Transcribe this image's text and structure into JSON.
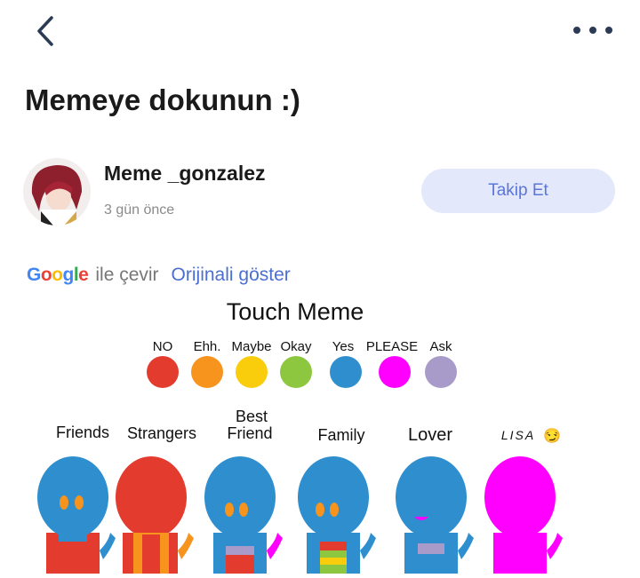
{
  "nav": {
    "back_icon": "chevron-left-icon",
    "more_icon": "more-horizontal-icon"
  },
  "post": {
    "title": "Memeye dokunun :)",
    "author": "Meme _gonzalez",
    "time": "3 gün önce",
    "follow_label": "Takip Et"
  },
  "translate": {
    "google_letters": [
      "G",
      "o",
      "o",
      "g",
      "l",
      "e"
    ],
    "ile_cevir": "ile çevir",
    "original_link": "Orijinali göster"
  },
  "meme": {
    "title": "Touch Meme",
    "legend": [
      {
        "label": "NO",
        "color": "#e33b2e"
      },
      {
        "label": "Ehh.",
        "color": "#f7941d"
      },
      {
        "label": "Maybe",
        "color": "#f9cd0b"
      },
      {
        "label": "Okay",
        "color": "#8dc63f"
      },
      {
        "label": "Yes",
        "color": "#2f8fce"
      },
      {
        "label": "PLEASE",
        "color": "#ff00ff"
      },
      {
        "label": "Ask",
        "color": "#a89ac9"
      }
    ],
    "categories": [
      {
        "label": "Friends"
      },
      {
        "label": "Strangers"
      },
      {
        "label": "Best",
        "label2": "Friend"
      },
      {
        "label": "Family"
      },
      {
        "label": "Lover"
      },
      {
        "label": "LISA",
        "emoji": "😏"
      }
    ]
  }
}
